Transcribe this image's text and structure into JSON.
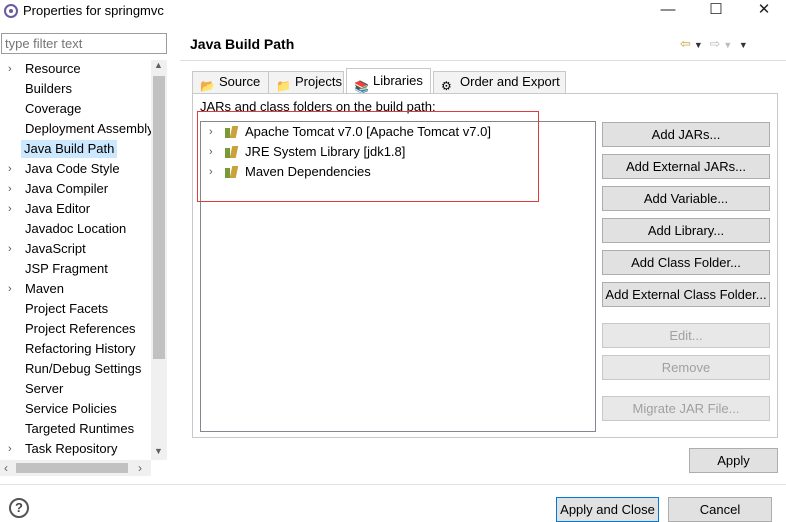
{
  "window": {
    "title": "Properties for springmvc",
    "minimize": "—",
    "maximize": "☐",
    "close": "✕"
  },
  "filter": {
    "placeholder": "type filter text"
  },
  "nav": {
    "items": [
      {
        "label": "Resource",
        "expandable": true
      },
      {
        "label": "Builders",
        "expandable": false
      },
      {
        "label": "Coverage",
        "expandable": false
      },
      {
        "label": "Deployment Assembly",
        "expandable": false
      },
      {
        "label": "Java Build Path",
        "expandable": false,
        "selected": true
      },
      {
        "label": "Java Code Style",
        "expandable": true
      },
      {
        "label": "Java Compiler",
        "expandable": true
      },
      {
        "label": "Java Editor",
        "expandable": true
      },
      {
        "label": "Javadoc Location",
        "expandable": false
      },
      {
        "label": "JavaScript",
        "expandable": true
      },
      {
        "label": "JSP Fragment",
        "expandable": false
      },
      {
        "label": "Maven",
        "expandable": true
      },
      {
        "label": "Project Facets",
        "expandable": false
      },
      {
        "label": "Project References",
        "expandable": false
      },
      {
        "label": "Refactoring History",
        "expandable": false
      },
      {
        "label": "Run/Debug Settings",
        "expandable": false
      },
      {
        "label": "Server",
        "expandable": false
      },
      {
        "label": "Service Policies",
        "expandable": false
      },
      {
        "label": "Targeted Runtimes",
        "expandable": false
      },
      {
        "label": "Task Repository",
        "expandable": true
      }
    ]
  },
  "page": {
    "title": "Java Build Path",
    "tabs": [
      {
        "label": "Source",
        "icon": "source-folder-icon"
      },
      {
        "label": "Projects",
        "icon": "projects-icon"
      },
      {
        "label": "Libraries",
        "icon": "libraries-icon",
        "active": true
      },
      {
        "label": "Order and Export",
        "icon": "order-export-icon"
      }
    ],
    "jars_label": "JARs and class folders on the build path:",
    "libraries": [
      {
        "label": "Apache Tomcat v7.0 [Apache Tomcat v7.0]"
      },
      {
        "label": "JRE System Library [jdk1.8]"
      },
      {
        "label": "Maven Dependencies"
      }
    ],
    "buttons": {
      "add_jars": "Add JARs...",
      "add_external_jars": "Add External JARs...",
      "add_variable": "Add Variable...",
      "add_library": "Add Library...",
      "add_class_folder": "Add Class Folder...",
      "add_external_class_folder": "Add External Class Folder...",
      "edit": "Edit...",
      "remove": "Remove",
      "migrate_jar": "Migrate JAR File..."
    },
    "apply": "Apply"
  },
  "footer": {
    "help": "?",
    "apply_and_close": "Apply and Close",
    "cancel": "Cancel"
  },
  "colors": {
    "selection": "#cce8ff",
    "highlight_box": "#e03c3c",
    "primary_border": "#0078d7"
  }
}
